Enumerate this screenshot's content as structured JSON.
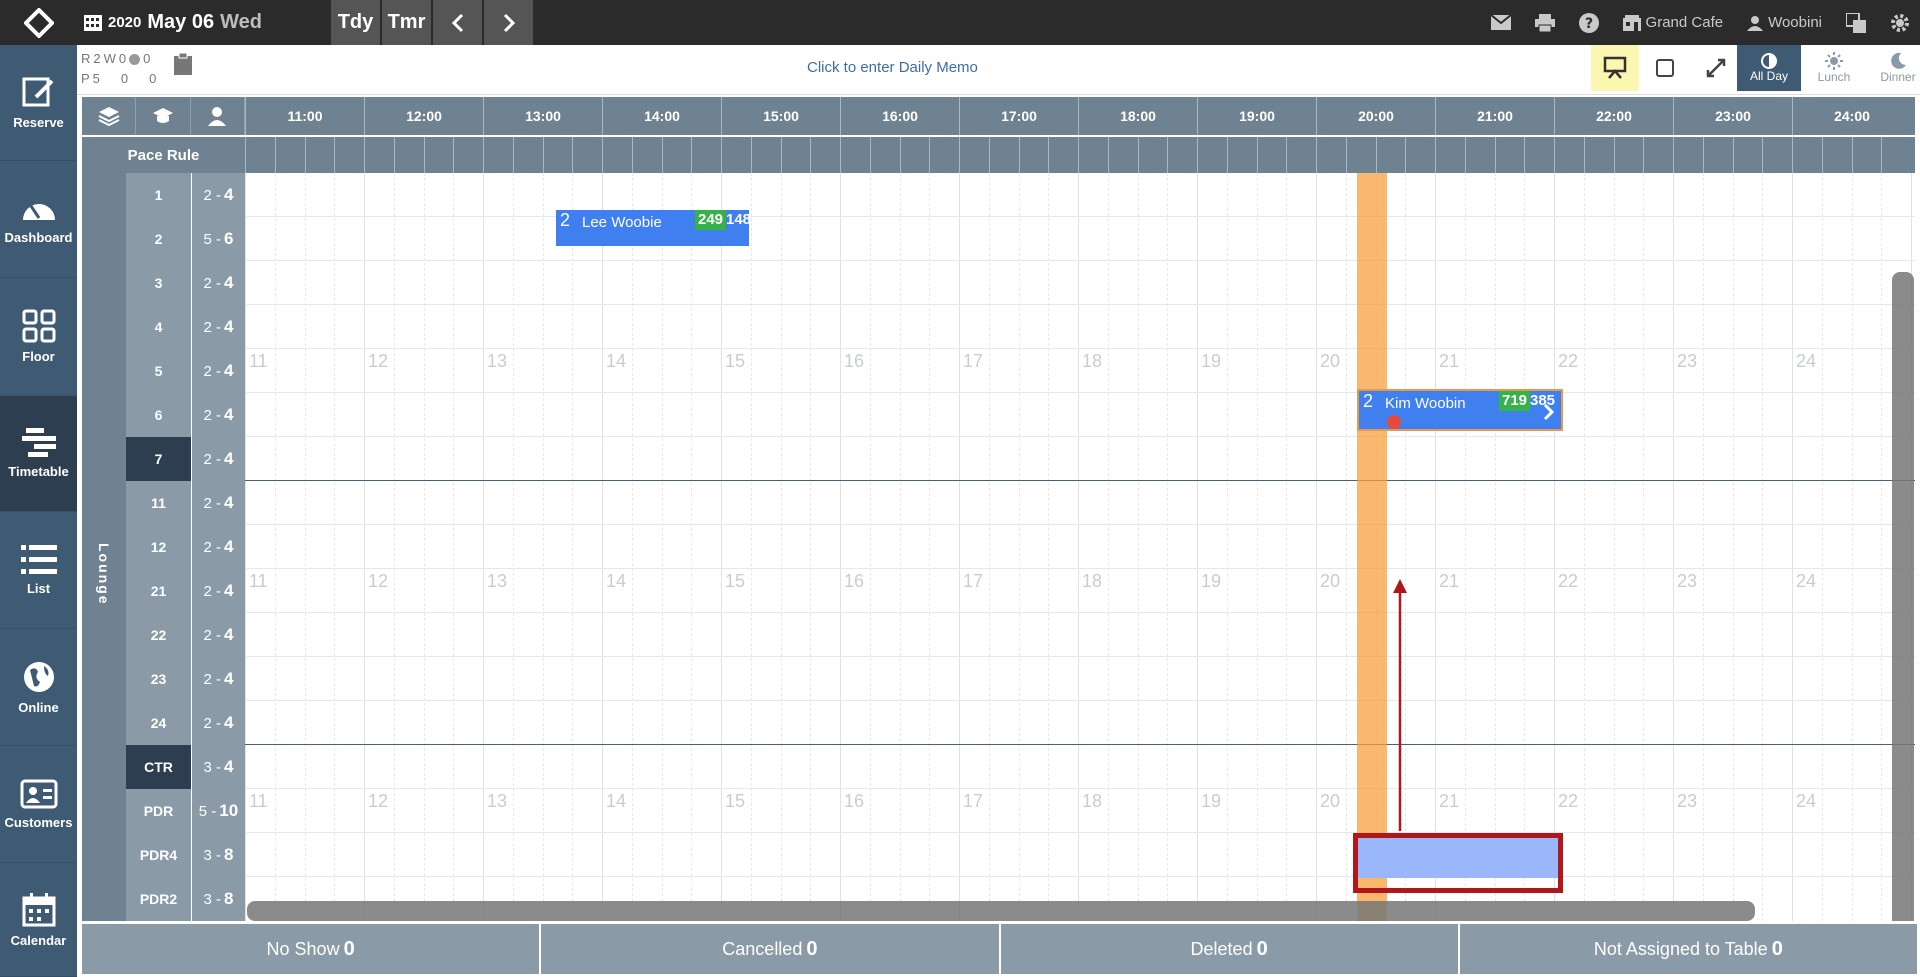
{
  "topbar": {
    "year": "2020",
    "month_day": "May 06",
    "weekday": "Wed",
    "today_label": "Tdy",
    "tomorrow_label": "Tmr",
    "restaurant": "Grand Cafe",
    "user": "Woobini"
  },
  "sidebar": {
    "items": [
      {
        "label": "Reserve",
        "icon": "edit-icon"
      },
      {
        "label": "Dashboard",
        "icon": "gauge-icon"
      },
      {
        "label": "Floor",
        "icon": "grid-icon"
      },
      {
        "label": "Timetable",
        "icon": "timetable-icon"
      },
      {
        "label": "List",
        "icon": "list-icon"
      },
      {
        "label": "Online",
        "icon": "globe-icon"
      },
      {
        "label": "Customers",
        "icon": "id-card-icon"
      },
      {
        "label": "Calendar",
        "icon": "calendar-icon"
      }
    ]
  },
  "stats": {
    "r_label": "R",
    "r_value": "2",
    "w_label": "W",
    "w_value": "0",
    "o_value": "0",
    "p_label": "P",
    "p_value": "5",
    "p2": "0",
    "p3": "0"
  },
  "memo": "Click to enter Daily Memo",
  "modes": {
    "all_day": "All Day",
    "lunch": "Lunch",
    "dinner": "Dinner"
  },
  "pace_rule_label": "Pace Rule",
  "section_name": "Lounge",
  "hours": [
    "11:00",
    "12:00",
    "13:00",
    "14:00",
    "15:00",
    "16:00",
    "17:00",
    "18:00",
    "19:00",
    "20:00",
    "21:00",
    "22:00",
    "23:00",
    "24:00"
  ],
  "hour_watermarks": [
    "11",
    "12",
    "13",
    "14",
    "15",
    "16",
    "17",
    "18",
    "19",
    "20",
    "21",
    "22",
    "23",
    "24"
  ],
  "tables": [
    {
      "name": "1",
      "min": "2",
      "max": "4"
    },
    {
      "name": "2",
      "min": "5",
      "max": "6"
    },
    {
      "name": "3",
      "min": "2",
      "max": "4"
    },
    {
      "name": "4",
      "min": "2",
      "max": "4"
    },
    {
      "name": "5",
      "min": "2",
      "max": "4"
    },
    {
      "name": "6",
      "min": "2",
      "max": "4"
    },
    {
      "name": "7",
      "min": "2",
      "max": "4"
    },
    {
      "name": "11",
      "min": "2",
      "max": "4"
    },
    {
      "name": "12",
      "min": "2",
      "max": "4"
    },
    {
      "name": "21",
      "min": "2",
      "max": "4"
    },
    {
      "name": "22",
      "min": "2",
      "max": "4"
    },
    {
      "name": "23",
      "min": "2",
      "max": "4"
    },
    {
      "name": "24",
      "min": "2",
      "max": "4"
    },
    {
      "name": "CTR",
      "min": "3",
      "max": "4"
    },
    {
      "name": "PDR",
      "min": "5",
      "max": "10"
    },
    {
      "name": "PDR4",
      "min": "3",
      "max": "8"
    },
    {
      "name": "PDR2",
      "min": "3",
      "max": "8"
    }
  ],
  "reservations": [
    {
      "size": "2",
      "name": "Lee Woobie",
      "num1": "249",
      "num2": "148"
    },
    {
      "size": "2",
      "name": "Kim Woobin",
      "num1": "719",
      "num2": "385"
    }
  ],
  "footer": {
    "no_show_label": "No Show",
    "no_show": "0",
    "cancelled_label": "Cancelled",
    "cancelled": "0",
    "deleted_label": "Deleted",
    "deleted": "0",
    "not_assigned_label": "Not Assigned to Table",
    "not_assigned": "0"
  },
  "colors": {
    "sidebar": "#3f5a73",
    "reservation": "#3f7ff0",
    "now": "#f7a03c",
    "highlight": "#b0171b"
  }
}
